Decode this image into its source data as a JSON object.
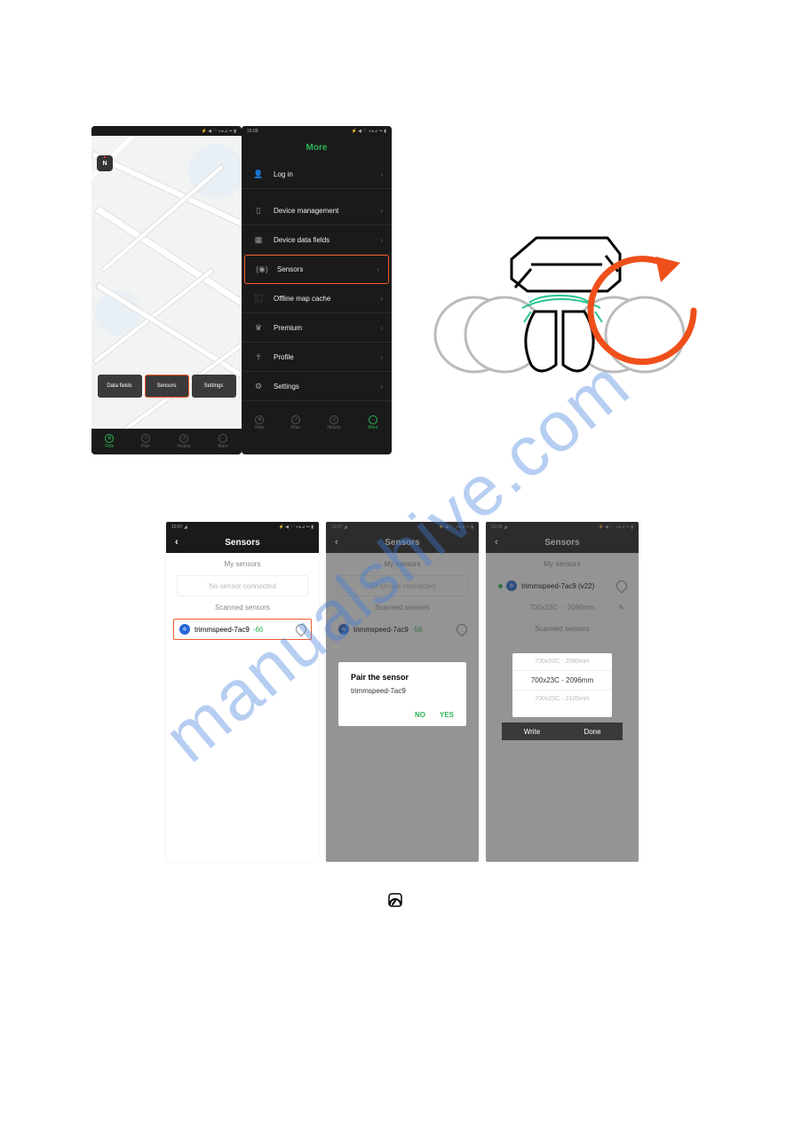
{
  "watermark": "manualshive.com",
  "phone1": {
    "status_left": "",
    "status_right": "⚡ ◀ ♡ ◑ ▸⊿ ⏦ ▮",
    "compass": "N",
    "buttons": {
      "datafields": "Data fields",
      "sensors": "Sensors",
      "settings": "Settings"
    },
    "nav": {
      "ride": "Ride",
      "plan": "Plan",
      "history": "History",
      "more": "More"
    }
  },
  "phone2": {
    "status_left": "15:08",
    "status_right": "⚡ ◀ ♡ ◑ ▸⊿ ⏦ ▮",
    "title": "More",
    "items": {
      "login": "Log in",
      "device": "Device management",
      "fields": "Device data fields",
      "sensors": "Sensors",
      "offline": "Offline map cache",
      "premium": "Premium",
      "profile": "Profile",
      "settings": "Settings"
    },
    "nav": {
      "ride": "Ride",
      "plan": "Plan",
      "history": "History",
      "more": "More"
    }
  },
  "sensors1": {
    "status_left": "10:07 ◢",
    "status_right": "⚡ ◀ ♡ ◑ ▸⊿ ⏦ ▮",
    "title": "Sensors",
    "my": "My sensors",
    "empty": "No sensor connected",
    "scanned": "Scanned sensors",
    "device": "trimmspeed-7ac9",
    "rssi": "-66"
  },
  "sensors2": {
    "status_left": "10:07 ◢",
    "status_right": "⚡ ◀ ♡ ◑ ▸⊿ ⏦ ▮",
    "title": "Sensors",
    "my": "My sensors",
    "empty": "No sensor connected",
    "scanned": "Scanned sensors",
    "device": "trimmspeed-7ac9",
    "rssi": "-56",
    "pair_title": "Pair the sensor",
    "pair_sub": "trimmspeed-7ac9",
    "no": "NO",
    "yes": "YES"
  },
  "sensors3": {
    "status_left": "10:08 ◢",
    "status_right": "⚡ ◀ ♡ ◑ ▸⊿ ⏦ ▮",
    "title": "Sensors",
    "my": "My sensors",
    "device": "trimmspeed-7ac9 (v22)",
    "wheel_label": "700x23C",
    "wheel_mm": "2096mm",
    "scanned": "Scanned sensors",
    "picker": {
      "a": "700x20C - 2080mm",
      "b": "700x23C - 2096mm",
      "c": "700x25C - 2105mm"
    },
    "write": "Write",
    "done": "Done"
  }
}
